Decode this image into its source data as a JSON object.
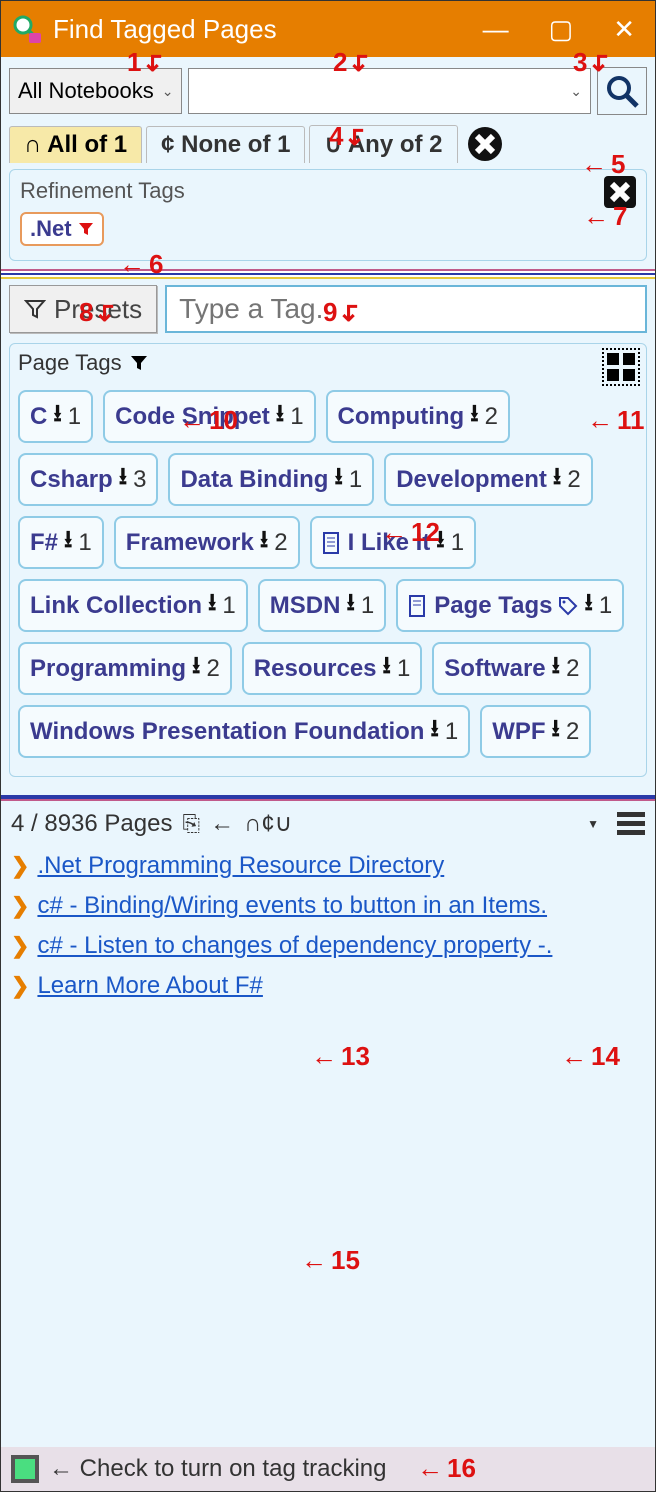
{
  "window": {
    "title": "Find Tagged Pages"
  },
  "toolbar": {
    "scope": "All Notebooks",
    "search_value": "",
    "search_placeholder": ""
  },
  "tabs": {
    "all": "∩ All of 1",
    "none": "¢ None of 1",
    "any": "∪ Any of 2"
  },
  "refinement": {
    "legend": "Refinement Tags",
    "tags": [
      {
        "label": ".Net"
      }
    ]
  },
  "presets": {
    "button": "Presets",
    "input_placeholder": "Type a Tag."
  },
  "pagetags": {
    "legend": "Page Tags",
    "items": [
      {
        "label": "C",
        "count": "1",
        "icon": null
      },
      {
        "label": "Code Snippet",
        "count": "1",
        "icon": null
      },
      {
        "label": "Computing",
        "count": "2",
        "icon": null
      },
      {
        "label": "Csharp",
        "count": "3",
        "icon": null
      },
      {
        "label": "Data Binding",
        "count": "1",
        "icon": null
      },
      {
        "label": "Development",
        "count": "2",
        "icon": null
      },
      {
        "label": "F#",
        "count": "1",
        "icon": null
      },
      {
        "label": "Framework",
        "count": "2",
        "icon": null
      },
      {
        "label": "I Like It",
        "count": "1",
        "icon": "note"
      },
      {
        "label": "Link Collection",
        "count": "1",
        "icon": null
      },
      {
        "label": "MSDN",
        "count": "1",
        "icon": null
      },
      {
        "label": "Page Tags",
        "count": "1",
        "icon": "note-tag"
      },
      {
        "label": "Programming",
        "count": "2",
        "icon": null
      },
      {
        "label": "Resources",
        "count": "1",
        "icon": null
      },
      {
        "label": "Software",
        "count": "2",
        "icon": null
      },
      {
        "label": "Windows Presentation Foundation",
        "count": "1",
        "icon": null
      },
      {
        "label": "WPF",
        "count": "2",
        "icon": null
      }
    ]
  },
  "results": {
    "counter": "4 / 8936 Pages",
    "ops": "∩¢∪",
    "items": [
      ".Net Programming Resource Directory",
      "c# - Binding/Wiring events to button in an Items.",
      "c# - Listen to changes of dependency property -.",
      "Learn More About F#"
    ]
  },
  "footer": {
    "label": "← Check to turn on tag tracking"
  },
  "annotations": {
    "1": "1",
    "2": "2",
    "3": "3",
    "4": "4",
    "5": "5",
    "6": "6",
    "7": "7",
    "8": "8",
    "9": "9",
    "10": "10",
    "11": "11",
    "12": "12",
    "13": "13",
    "14": "14",
    "15": "15",
    "16": "16"
  }
}
